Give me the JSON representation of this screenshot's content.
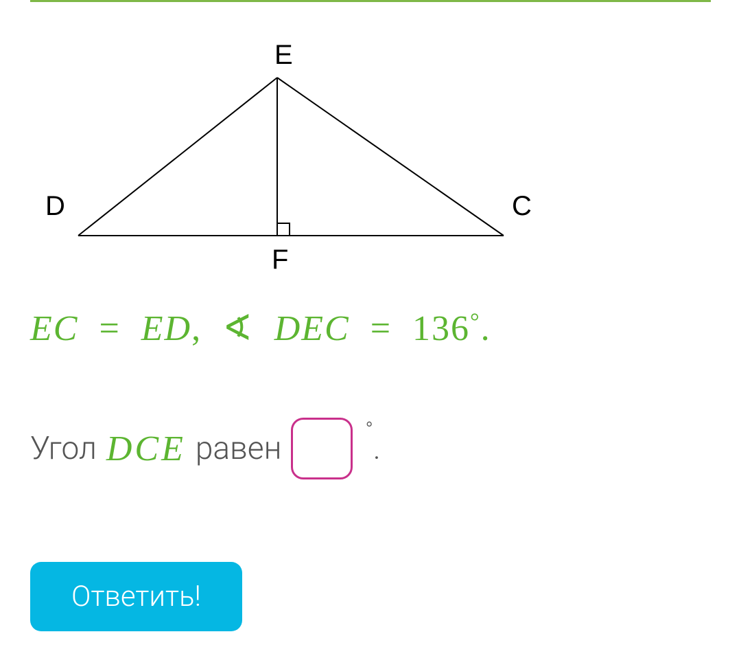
{
  "triangle": {
    "vertex_top": "E",
    "vertex_left": "D",
    "vertex_right": "C",
    "foot_label": "F"
  },
  "given": {
    "equality": "EC = ED",
    "angle_name": "DEC",
    "angle_value": "136",
    "degree_symbol": "°",
    "full_text": "EC = ED, ∢ DEC = 136°."
  },
  "question": {
    "prefix": "Угол",
    "angle_name": "DCE",
    "middle": "равен",
    "degree_symbol": "°",
    "period": "."
  },
  "submit_button": "Ответить!",
  "colors": {
    "accent_green": "#5cb531",
    "rule_green": "#7fb848",
    "input_border": "#c9308b",
    "button_bg": "#05b7e3"
  }
}
